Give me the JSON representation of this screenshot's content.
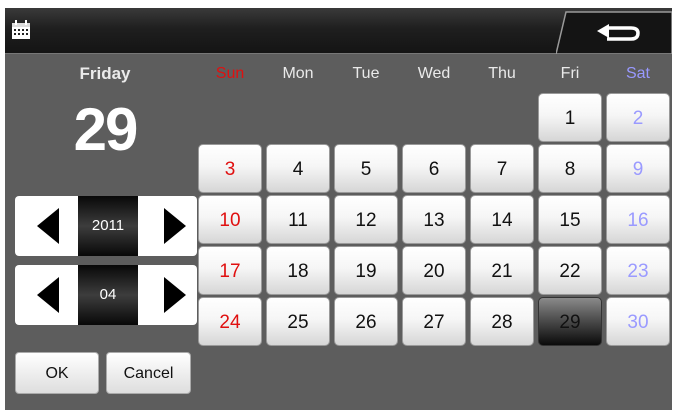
{
  "header": {
    "icons": {
      "calendar": "calendar-icon",
      "back": "return-arrow-icon"
    }
  },
  "selected": {
    "weekday": "Friday",
    "day": "29"
  },
  "year_spinner": {
    "value": "2011"
  },
  "month_spinner": {
    "value": "04"
  },
  "buttons": {
    "ok": "OK",
    "cancel": "Cancel"
  },
  "weekdays": [
    "Sun",
    "Mon",
    "Tue",
    "Wed",
    "Thu",
    "Fri",
    "Sat"
  ],
  "calendar": {
    "weeks": [
      [
        "",
        "",
        "",
        "",
        "",
        "1",
        "2"
      ],
      [
        "3",
        "4",
        "5",
        "6",
        "7",
        "8",
        "9"
      ],
      [
        "10",
        "11",
        "12",
        "13",
        "14",
        "15",
        "16"
      ],
      [
        "17",
        "18",
        "19",
        "20",
        "21",
        "22",
        "23"
      ],
      [
        "24",
        "25",
        "26",
        "27",
        "28",
        "29",
        "30"
      ]
    ],
    "selected_day": "29"
  },
  "colors": {
    "background": "#5d5d5d",
    "sunday": "#e01010",
    "saturday": "#9a9aff"
  }
}
